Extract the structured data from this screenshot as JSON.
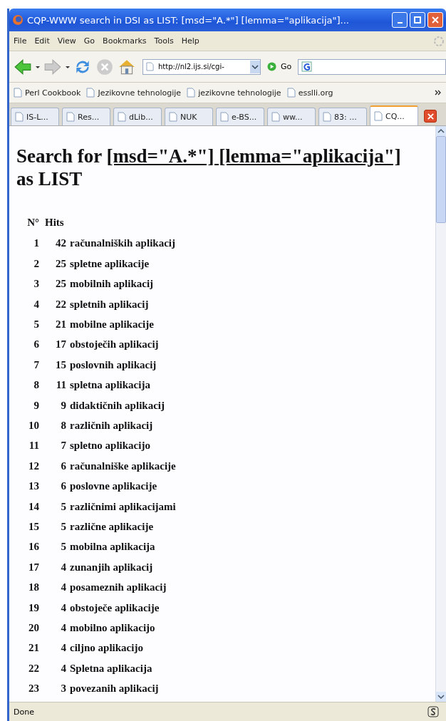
{
  "window": {
    "title": "CQP-WWW search in DSI as LIST: [msd=\"A.*\"] [lemma=\"aplikacija\"]..."
  },
  "menu": [
    "File",
    "Edit",
    "View",
    "Go",
    "Bookmarks",
    "Tools",
    "Help"
  ],
  "toolbar": {
    "url": "http://nl2.ijs.si/cgi-",
    "go": "Go"
  },
  "bookmarks": [
    "Perl Cookbook",
    "Jezikovne tehnologije",
    "jezikovne tehnologije",
    "esslli.org"
  ],
  "tabs": [
    {
      "label": "IS-L...",
      "selected": false
    },
    {
      "label": "Res...",
      "selected": false
    },
    {
      "label": "dLib...",
      "selected": false
    },
    {
      "label": "NUK",
      "selected": false
    },
    {
      "label": "e-BS...",
      "selected": false
    },
    {
      "label": "ww...",
      "selected": false
    },
    {
      "label": "83: ...",
      "selected": false
    },
    {
      "label": "CQ...",
      "selected": true
    }
  ],
  "page": {
    "heading_prefix": "Search for",
    "query": "[msd=\"A.*\"] [lemma=\"aplikacija\"]",
    "heading_suffix": "as LIST",
    "columns": [
      "N°",
      "Hits"
    ],
    "rows": [
      {
        "n": "1",
        "count": "42",
        "hit": "računalniških aplikacij"
      },
      {
        "n": "2",
        "count": "25",
        "hit": "spletne aplikacije"
      },
      {
        "n": "3",
        "count": "25",
        "hit": "mobilnih aplikacij"
      },
      {
        "n": "4",
        "count": "22",
        "hit": "spletnih aplikacij"
      },
      {
        "n": "5",
        "count": "21",
        "hit": "mobilne aplikacije"
      },
      {
        "n": "6",
        "count": "17",
        "hit": "obstoječih aplikacij"
      },
      {
        "n": "7",
        "count": "15",
        "hit": "poslovnih aplikacij"
      },
      {
        "n": "8",
        "count": "11",
        "hit": "spletna aplikacija"
      },
      {
        "n": "9",
        "count": "9",
        "hit": "didaktičnih aplikacij"
      },
      {
        "n": "10",
        "count": "8",
        "hit": "različnih aplikacij"
      },
      {
        "n": "11",
        "count": "7",
        "hit": "spletno aplikacijo"
      },
      {
        "n": "12",
        "count": "6",
        "hit": "računalniške aplikacije"
      },
      {
        "n": "13",
        "count": "6",
        "hit": "poslovne aplikacije"
      },
      {
        "n": "14",
        "count": "5",
        "hit": "različnimi aplikacijami"
      },
      {
        "n": "15",
        "count": "5",
        "hit": "različne aplikacije"
      },
      {
        "n": "16",
        "count": "5",
        "hit": "mobilna aplikacija"
      },
      {
        "n": "17",
        "count": "4",
        "hit": "zunanjih aplikacij"
      },
      {
        "n": "18",
        "count": "4",
        "hit": "posameznih aplikacij"
      },
      {
        "n": "19",
        "count": "4",
        "hit": "obstoječe aplikacije"
      },
      {
        "n": "20",
        "count": "4",
        "hit": "mobilno aplikacijo"
      },
      {
        "n": "21",
        "count": "4",
        "hit": "ciljno aplikacijo"
      },
      {
        "n": "22",
        "count": "4",
        "hit": "Spletna aplikacija"
      },
      {
        "n": "23",
        "count": "3",
        "hit": "povezanih aplikacij"
      }
    ]
  },
  "status_bar": "Done"
}
